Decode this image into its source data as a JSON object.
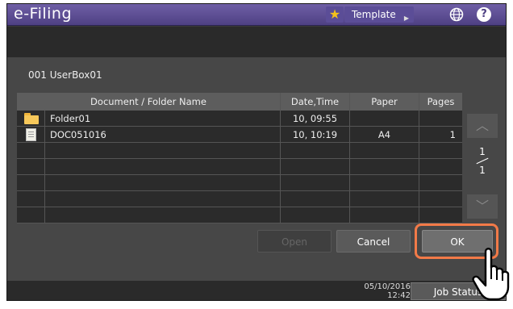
{
  "titlebar": {
    "title": "e-Filing",
    "favorite_icon": "star-icon",
    "template_label": "Template",
    "language_icon": "globe-icon",
    "help_label": "?"
  },
  "box": {
    "label": "001 UserBox01"
  },
  "table": {
    "headers": {
      "name": "Document / Folder Name",
      "date": "Date,Time",
      "paper": "Paper",
      "pages": "Pages"
    },
    "rows": [
      {
        "icon": "folder-icon",
        "name": "Folder01",
        "date": "10, 09:55",
        "paper": "",
        "pages": ""
      },
      {
        "icon": "document-icon",
        "name": "DOC051016",
        "date": "10, 10:19",
        "paper": "A4",
        "pages": "1"
      }
    ]
  },
  "pager": {
    "current": "1",
    "total": "1"
  },
  "actions": {
    "open": "Open",
    "cancel": "Cancel",
    "ok": "OK"
  },
  "status": {
    "date": "05/10/2016",
    "time": "12:42",
    "job_status": "Job Status"
  },
  "colors": {
    "titlebar": "#4e4083",
    "highlight": "#f27a48"
  }
}
